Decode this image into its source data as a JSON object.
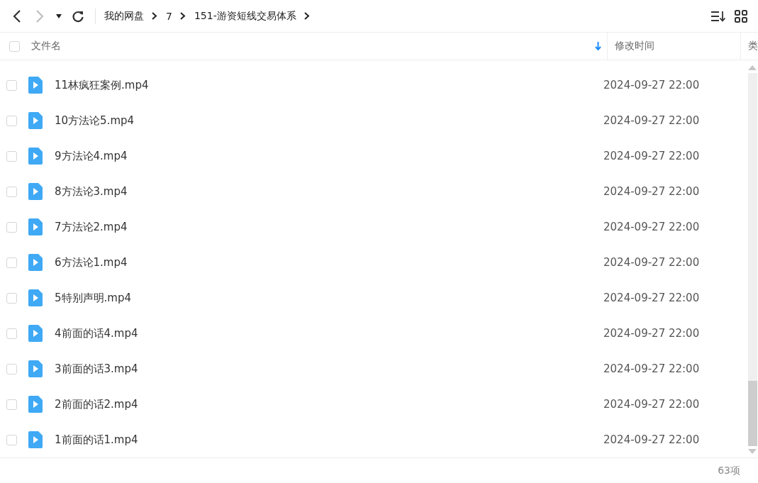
{
  "breadcrumbs": [
    {
      "label": "我的网盘"
    },
    {
      "label": "7"
    },
    {
      "label": "151-游资短线交易体系"
    }
  ],
  "columns": [
    {
      "label": "文件名",
      "sorted": true
    },
    {
      "label": "修改时间",
      "sorted": false
    },
    {
      "label": "类",
      "sorted": false
    }
  ],
  "header_checked": false,
  "files": [
    {
      "name": "11林疯狂案例.mp4",
      "modified": "2024-09-27 22:00",
      "checked": false
    },
    {
      "name": "10方法论5.mp4",
      "modified": "2024-09-27 22:00",
      "checked": false
    },
    {
      "name": "9方法论4.mp4",
      "modified": "2024-09-27 22:00",
      "checked": false
    },
    {
      "name": "8方法论3.mp4",
      "modified": "2024-09-27 22:00",
      "checked": false
    },
    {
      "name": "7方法论2.mp4",
      "modified": "2024-09-27 22:00",
      "checked": false
    },
    {
      "name": "6方法论1.mp4",
      "modified": "2024-09-27 22:00",
      "checked": false
    },
    {
      "name": "5特别声明.mp4",
      "modified": "2024-09-27 22:00",
      "checked": false
    },
    {
      "name": "4前面的话4.mp4",
      "modified": "2024-09-27 22:00",
      "checked": false
    },
    {
      "name": "3前面的话3.mp4",
      "modified": "2024-09-27 22:00",
      "checked": false
    },
    {
      "name": "2前面的话2.mp4",
      "modified": "2024-09-27 22:00",
      "checked": false
    },
    {
      "name": "1前面的话1.mp4",
      "modified": "2024-09-27 22:00",
      "checked": false
    }
  ],
  "item_count": "63项"
}
